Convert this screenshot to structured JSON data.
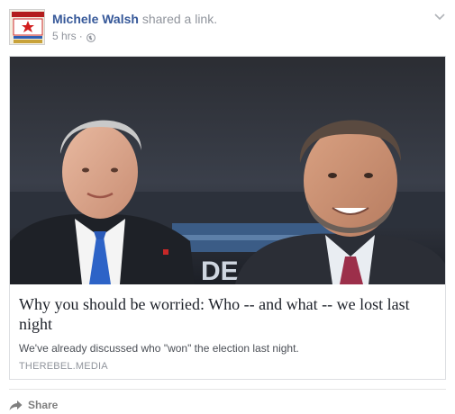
{
  "post": {
    "author_name": "Michele Walsh",
    "action_text": "shared a link.",
    "timestamp": "5 hrs",
    "separator": "·",
    "privacy_icon": "globe-icon",
    "menu_icon": "chevron-down-icon"
  },
  "link": {
    "title": "Why you should be worried: Who -- and what -- we lost last night",
    "description": "We've already discussed who \"won\" the election last night.",
    "domain": "THEREBEL.MEDIA",
    "image_text": "DE"
  },
  "footer": {
    "share_label": "Share",
    "share_icon": "share-arrow-icon"
  },
  "colors": {
    "author_link": "#365899",
    "meta_gray": "#90949c",
    "title_text": "#1d2129",
    "card_border": "#dddfe2"
  }
}
